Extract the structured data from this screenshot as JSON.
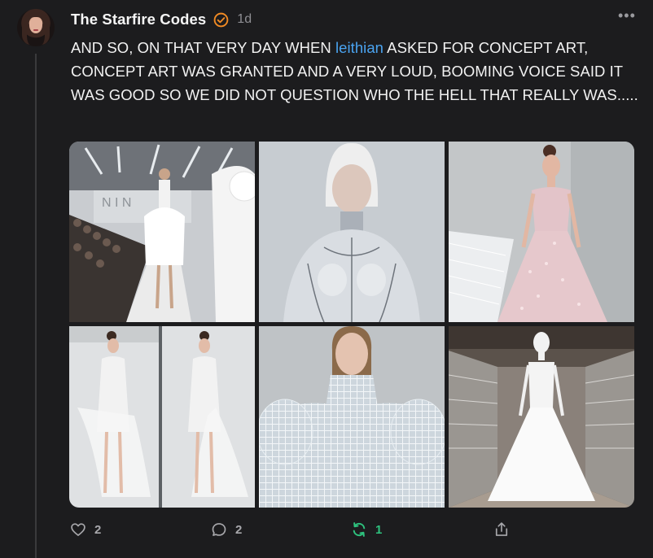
{
  "post": {
    "author": "The Starfire Codes",
    "time": "1d",
    "text_before": "AND SO, ON THAT VERY DAY WHEN ",
    "mention": "leithian",
    "text_after": " ASKED FOR CONCEPT ART, CONCEPT ART WAS GRANTED AND A VERY LOUD, BOOMING VOICE SAID IT WAS GOOD SO WE DID NOT QUESTION WHO THE HELL THAT REALLY WAS.....",
    "more_label": "•••"
  },
  "images": [
    {
      "name": "runway-white-ruffle-dress-image"
    },
    {
      "name": "silver-android-woman-image"
    },
    {
      "name": "pink-embellished-gown-image"
    },
    {
      "name": "white-dress-mirrored-pair-image"
    },
    {
      "name": "white-lattice-puff-sleeve-image"
    },
    {
      "name": "mannequin-white-gown-warehouse-image"
    }
  ],
  "actions": {
    "likes": "2",
    "replies": "2",
    "reposts": "1"
  },
  "colors": {
    "background": "#1c1c1e",
    "mention": "#4aa3f0",
    "verified": "#f08a24",
    "repost": "#2ec27e",
    "muted": "#8e8e93"
  },
  "icons": [
    "verified-badge-icon",
    "more-options-icon",
    "heart-icon",
    "reply-icon",
    "repost-icon",
    "share-icon"
  ]
}
